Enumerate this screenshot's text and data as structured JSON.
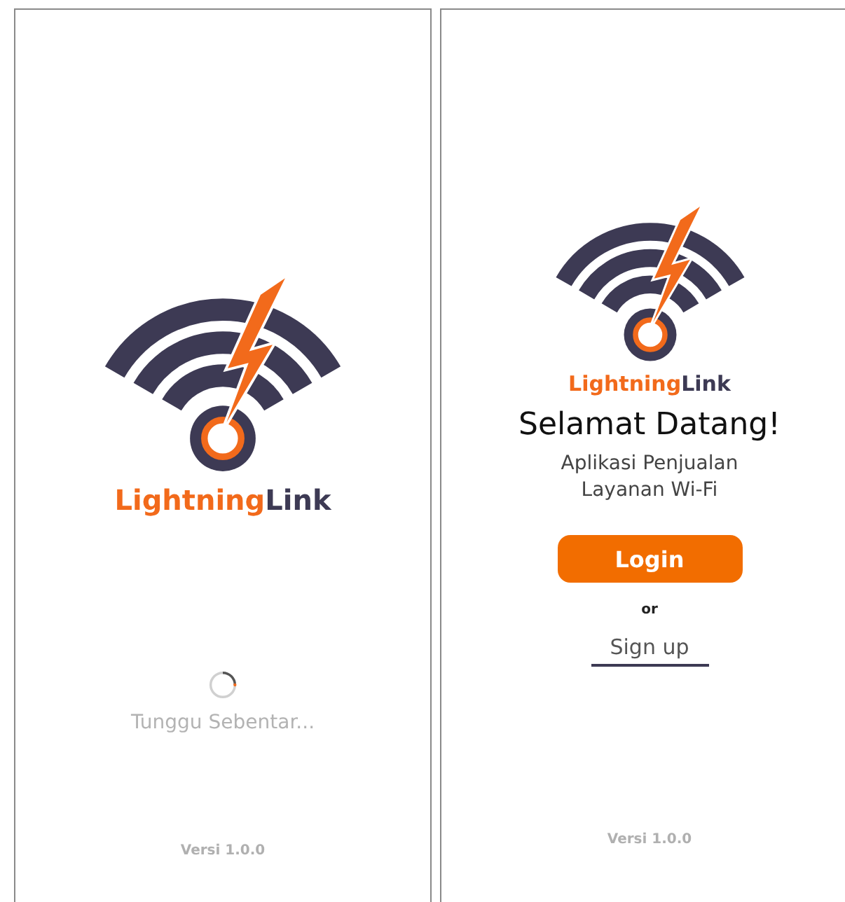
{
  "splash_screen": {
    "brand": {
      "first": "Lightning",
      "second": "Link"
    },
    "loading_text": "Tunggu Sebentar...",
    "version": "Versi 1.0.0"
  },
  "welcome_screen": {
    "brand": {
      "first": "Lightning",
      "second": "Link"
    },
    "title": "Selamat Datang!",
    "subtitle": "Aplikasi Penjualan Layanan Wi-Fi",
    "login_button": "Login",
    "separator": "or",
    "signup_link": "Sign up",
    "version": "Versi 1.0.0"
  }
}
